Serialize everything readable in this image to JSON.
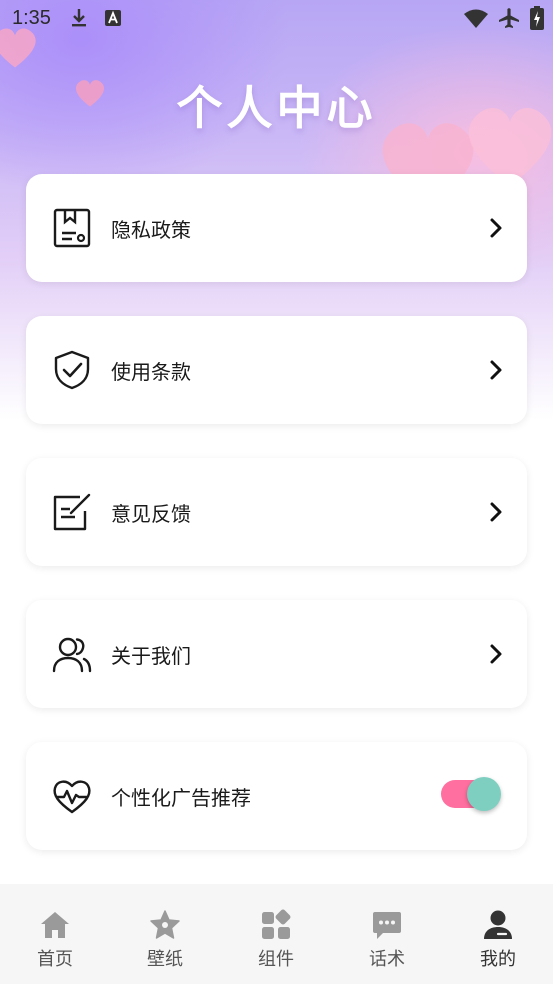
{
  "status_bar": {
    "time": "1:35",
    "icons": [
      "download-icon",
      "text-a-icon",
      "wifi-icon",
      "airplane-icon",
      "battery-charging-icon"
    ]
  },
  "header": {
    "title": "个人中心"
  },
  "menu": {
    "items": [
      {
        "label": "隐私政策",
        "icon": "document-icon",
        "action": "chevron-right-icon"
      },
      {
        "label": "使用条款",
        "icon": "shield-check-icon",
        "action": "chevron-right-icon"
      },
      {
        "label": "意见反馈",
        "icon": "edit-note-icon",
        "action": "chevron-right-icon"
      },
      {
        "label": "关于我们",
        "icon": "users-icon",
        "action": "chevron-right-icon"
      },
      {
        "label": "个性化广告推荐",
        "icon": "heart-pulse-icon",
        "action": "toggle",
        "toggle_on": true
      }
    ]
  },
  "tab_bar": {
    "tabs": [
      {
        "label": "首页",
        "icon": "home-icon",
        "active": false
      },
      {
        "label": "壁纸",
        "icon": "star-icon",
        "active": false
      },
      {
        "label": "组件",
        "icon": "widgets-icon",
        "active": false
      },
      {
        "label": "话术",
        "icon": "chat-icon",
        "active": false
      },
      {
        "label": "我的",
        "icon": "profile-icon",
        "active": true
      }
    ]
  },
  "colors": {
    "accent_pink": "#ff6f9f",
    "toggle_knob": "#7fcfc1",
    "tab_icon": "#9a9a9a",
    "tab_icon_active": "#333333"
  }
}
